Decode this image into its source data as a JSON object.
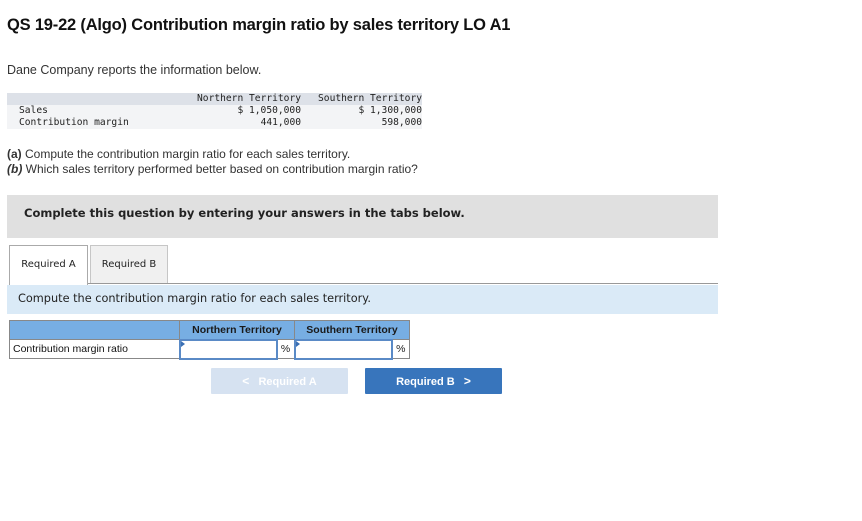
{
  "header": {
    "title": "QS 19-22 (Algo) Contribution margin ratio by sales territory LO A1"
  },
  "intro": "Dane Company reports the information below.",
  "data_table": {
    "columns": [
      "",
      "Northern Territory",
      "Southern Territory"
    ],
    "rows": [
      {
        "label": "Sales",
        "northern": "$ 1,050,000",
        "southern": "$ 1,300,000"
      },
      {
        "label": "Contribution margin",
        "northern": "441,000",
        "southern": "598,000"
      }
    ]
  },
  "questions": [
    {
      "tag": "(a)",
      "text": " Compute the contribution margin ratio for each sales territory."
    },
    {
      "tag": "(b)",
      "text": " Which sales territory performed better based on contribution margin ratio?"
    }
  ],
  "banner": "Complete this question by entering your answers in the tabs below.",
  "tabs": [
    {
      "label": "Required A",
      "active": true
    },
    {
      "label": "Required B",
      "active": false
    }
  ],
  "instruction": "Compute the contribution margin ratio for each sales territory.",
  "answer_table": {
    "columns": [
      "",
      "Northern Territory",
      "Southern Territory"
    ],
    "row_label": "Contribution margin ratio",
    "northern_value": "",
    "southern_value": "",
    "unit": "%"
  },
  "nav": {
    "prev_label": "Required A",
    "next_label": "Required B",
    "prev_icon": "chevron-left-icon",
    "next_icon": "chevron-right-icon"
  },
  "colors": {
    "header_blue": "#77aee3",
    "button_blue": "#3875bc",
    "button_disabled": "#d6e2f1",
    "instruction_bg": "#daeaf7",
    "banner_bg": "#e0e0e0"
  }
}
